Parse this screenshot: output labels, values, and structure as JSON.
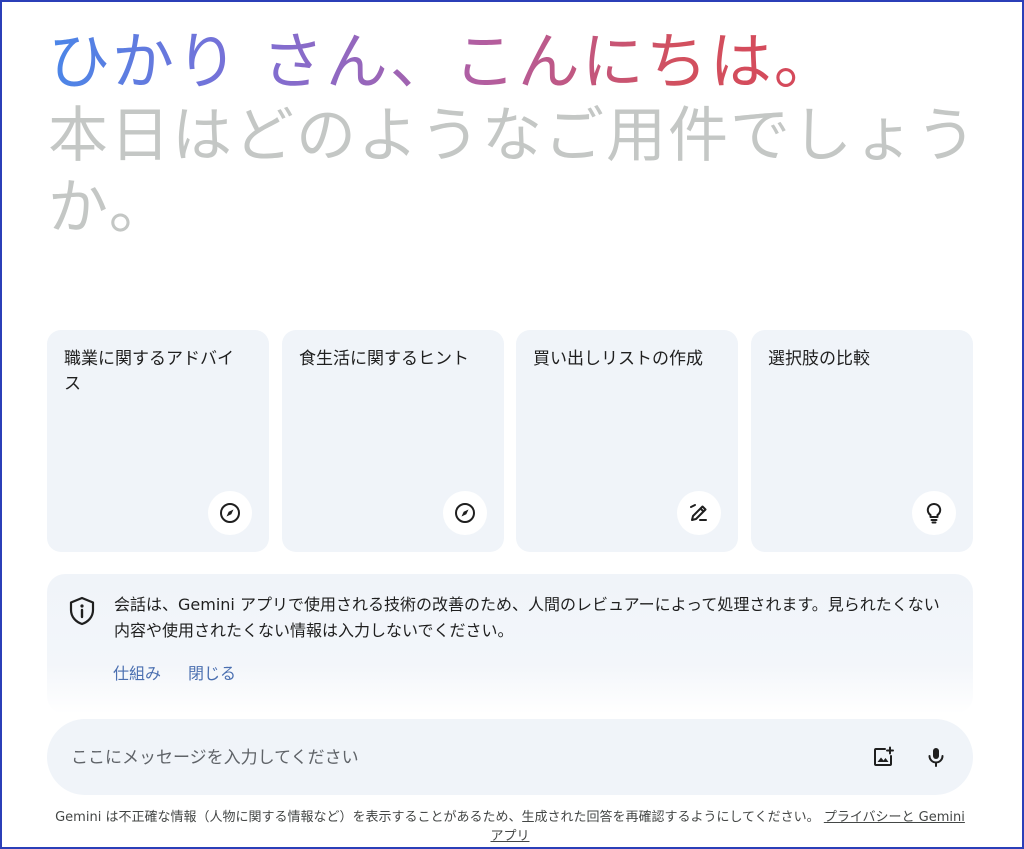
{
  "greeting": {
    "name_hello": "ひかり さん、こんにちは。",
    "subtitle": "本日はどのようなご用件でしょうか。"
  },
  "cards": [
    {
      "label": "職業に関するアドバイス",
      "icon": "compass-icon"
    },
    {
      "label": "食生活に関するヒント",
      "icon": "compass-icon"
    },
    {
      "label": "買い出しリストの作成",
      "icon": "pen-edit-icon"
    },
    {
      "label": "選択肢の比較",
      "icon": "lightbulb-icon"
    }
  ],
  "notice": {
    "text": "会話は、Gemini アプリで使用される技術の改善のため、人間のレビュアーによって処理されます。見られたくない内容や使用されたくない情報は入力しないでください。",
    "link_how": "仕組み",
    "link_close": "閉じる"
  },
  "input": {
    "placeholder": "ここにメッセージを入力してください",
    "image_button_icon": "add-image-icon",
    "mic_button_icon": "microphone-icon"
  },
  "footer": {
    "text": "Gemini は不正確な情報（人物に関する情報など）を表示することがあるため、生成された回答を再確認するようにしてください。",
    "link": "プライバシーと Gemini アプリ"
  },
  "colors": {
    "gradient": [
      "#4a86e8",
      "#7b6fd6",
      "#b25ea0",
      "#d6475a"
    ],
    "subtitle": "#c4c7c5",
    "card_bg": "#f0f4f9",
    "link": "#4a6fb0"
  }
}
